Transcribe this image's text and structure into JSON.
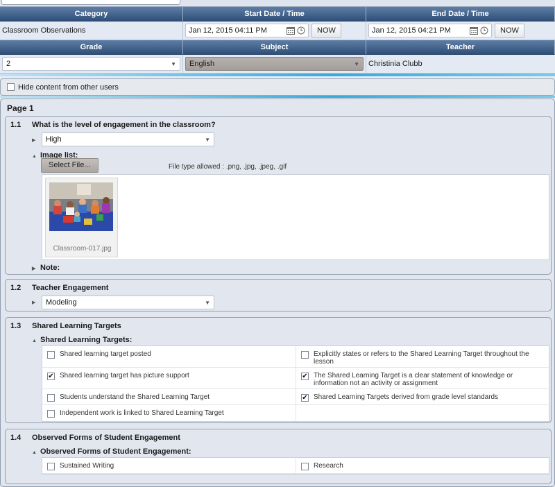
{
  "header": {
    "columns": [
      "Category",
      "Start Date / Time",
      "End Date / Time"
    ],
    "category_value": "Classroom Observations",
    "start_date": "Jan 12, 2015 04:11 PM",
    "end_date": "Jan 12, 2015 04:21 PM",
    "now_label": "NOW",
    "columns2": [
      "Grade",
      "Subject",
      "Teacher"
    ],
    "grade_value": "2",
    "subject_value": "English",
    "teacher_value": "Christinia Clubb"
  },
  "hide_content_label": "Hide content from other users",
  "page_title": "Page 1",
  "questions": [
    {
      "num": "1.1",
      "title": "What is the level of engagement in the classroom?",
      "select_value": "High",
      "image_list_label": "Image list:",
      "select_file_label": "Select File...",
      "file_types_note": "File type allowed : .png, .jpg, .jpeg, .gif",
      "image_filename": "Classroom-017.jpg",
      "note_label": "Note:"
    },
    {
      "num": "1.2",
      "title": "Teacher Engagement",
      "select_value": "Modeling"
    },
    {
      "num": "1.3",
      "title": "Shared Learning Targets",
      "sub_label": "Shared Learning Targets:",
      "items": [
        {
          "label": "Shared learning target posted",
          "checked": false
        },
        {
          "label": "Explicitly states or refers to the Shared Learning Target throughout the lesson",
          "checked": false
        },
        {
          "label": "Shared learning target has picture support",
          "checked": true
        },
        {
          "label": "The Shared Learning Target is a clear statement of knowledge or information not an activity or assignment",
          "checked": true
        },
        {
          "label": "Students understand the Shared Learning Target",
          "checked": false
        },
        {
          "label": "Shared Learning Targets derived from grade level standards",
          "checked": true
        },
        {
          "label": "Independent work is linked to Shared Learning Target",
          "checked": false
        },
        {
          "label": "",
          "checked": null
        }
      ]
    },
    {
      "num": "1.4",
      "title": "Observed Forms of Student Engagement",
      "sub_label": "Observed Forms of Student Engagement:",
      "items": [
        {
          "label": "Sustained Writing",
          "checked": false
        },
        {
          "label": "Research",
          "checked": false
        }
      ]
    }
  ],
  "icons": {
    "calendar": "calendar-icon",
    "clock": "clock-icon",
    "dropdown": "chevron-down-icon",
    "expand": "triangle-right-icon",
    "collapse": "triangle-down-icon"
  }
}
